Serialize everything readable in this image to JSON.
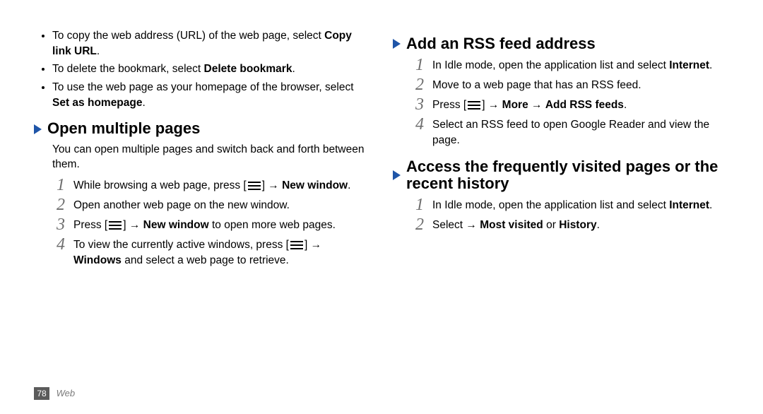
{
  "left": {
    "bullets": [
      {
        "pre": "To copy the web address (URL) of the web page, select ",
        "bold": "Copy link URL",
        "post": "."
      },
      {
        "pre": "To delete the bookmark, select ",
        "bold": "Delete bookmark",
        "post": "."
      },
      {
        "pre": "To use the web page as your homepage of the browser, select ",
        "bold": "Set as homepage",
        "post": "."
      }
    ],
    "section1": {
      "title": "Open multiple pages",
      "intro": "You can open multiple pages and switch back and forth between them.",
      "steps": [
        {
          "n": "1",
          "pre": "While browsing a web page, press [",
          "icon": "menu-icon",
          "seg2": "] → ",
          "bold": "New window",
          "post": "."
        },
        {
          "n": "2",
          "pre": "Open another web page on the new window."
        },
        {
          "n": "3",
          "pre": "Press [",
          "icon": "menu-icon",
          "seg2": "] → ",
          "bold": "New window",
          "post": " to open more web pages."
        },
        {
          "n": "4",
          "pre": "To view the currently active windows, press [",
          "icon": "menu-icon",
          "seg2": "] → ",
          "bold": "Windows",
          "post": " and select a web page to retrieve."
        }
      ]
    }
  },
  "right": {
    "section1": {
      "title": "Add an RSS feed address",
      "steps": [
        {
          "n": "1",
          "pre": "In Idle mode, open the application list and select ",
          "bold": "Internet",
          "post": "."
        },
        {
          "n": "2",
          "pre": "Move to a web page that has an RSS feed."
        },
        {
          "n": "3",
          "pre": "Press [",
          "icon": "menu-icon",
          "seg2": "] → ",
          "bold": "More",
          "seg3": " → ",
          "bold2": "Add RSS feeds",
          "post": "."
        },
        {
          "n": "4",
          "pre": "Select an RSS feed to open Google Reader and view the page."
        }
      ]
    },
    "section2": {
      "title": "Access the frequently visited pages or the recent history",
      "steps": [
        {
          "n": "1",
          "pre": "In Idle mode, open the application list and select ",
          "bold": "Internet",
          "post": "."
        },
        {
          "n": "2",
          "pre": "Select      → ",
          "bold": "Most visited",
          "seg3": " or ",
          "bold2": "History",
          "post": "."
        }
      ]
    }
  },
  "footer": {
    "page_num": "78",
    "section": "Web"
  }
}
